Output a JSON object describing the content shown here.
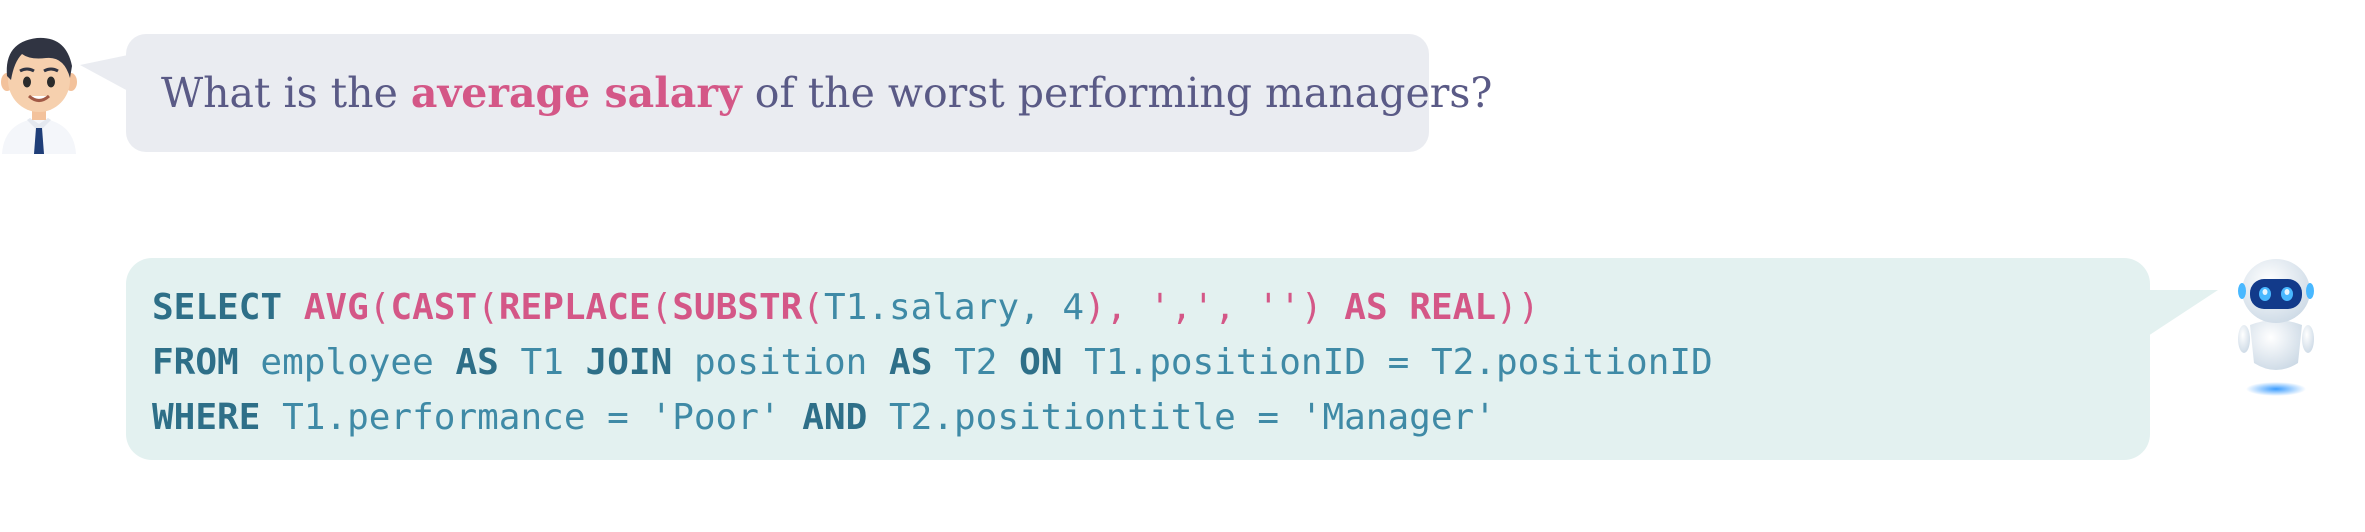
{
  "question": {
    "before": "What is the ",
    "highlight": "average salary",
    "after": " of the worst performing managers?"
  },
  "sql": {
    "line1": {
      "t1": "SELECT",
      "t2": "AVG",
      "t3": "(",
      "t4": "CAST",
      "t5": "(",
      "t6": "REPLACE",
      "t7": "(",
      "t8": "SUBSTR",
      "t9": "(",
      "t10": "T1.salary, 4",
      "t11": "),",
      "t12": "','",
      "t13": ",",
      "t14": "''",
      "t15": ")",
      "t16": "AS",
      "t17": "REAL",
      "t18": "))"
    },
    "line2": {
      "t1": "FROM",
      "t2": "employee",
      "t3": "AS",
      "t4": "T1",
      "t5": "JOIN",
      "t6": "position",
      "t7": "AS",
      "t8": "T2",
      "t9": "ON",
      "t10": "T1.positionID = T2.positionID"
    },
    "line3": {
      "t1": "WHERE",
      "t2": "T1.performance = 'Poor'",
      "t3": "AND",
      "t4": "T2.positiontitle = 'Manager'"
    }
  },
  "icons": {
    "user": "businessman-avatar-icon",
    "assistant": "robot-avatar-icon"
  },
  "colors": {
    "question_text": "#5a5a86",
    "highlight": "#d45787",
    "sql_keyword": "#2e6f88",
    "sql_text": "#3f8aa6",
    "question_bubble": "#eaecf1",
    "answer_bubble": "#e3f1f0"
  }
}
